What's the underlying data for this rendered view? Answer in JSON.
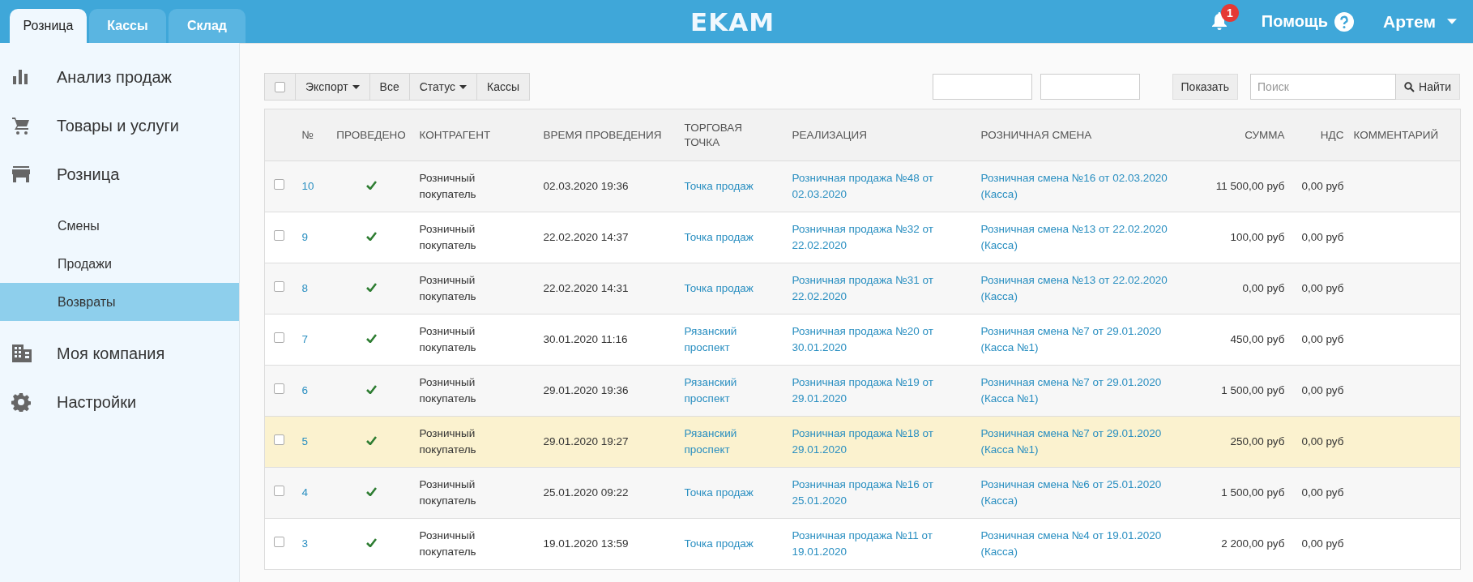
{
  "top_tabs": [
    {
      "label": "Розница",
      "selected": true
    },
    {
      "label": "Кассы",
      "selected": false
    },
    {
      "label": "Склад",
      "selected": false
    }
  ],
  "logo": "EKAM",
  "notifications": {
    "count": "1"
  },
  "help": "Помощь",
  "user": "Артем",
  "sidebar": {
    "items": [
      {
        "label": "Анализ продаж",
        "selected": false
      },
      {
        "label": "Товары и услуги",
        "selected": false
      },
      {
        "label": "Розница",
        "selected": false,
        "children": [
          {
            "label": "Смены",
            "selected": false
          },
          {
            "label": "Продажи",
            "selected": false
          },
          {
            "label": "Возвраты",
            "selected": true
          }
        ]
      },
      {
        "label": "Моя компания",
        "selected": false
      },
      {
        "label": "Настройки",
        "selected": false
      }
    ]
  },
  "toolbar": {
    "select_all": {
      "checked": false
    },
    "buttons": [
      {
        "label": "Экспорт",
        "dropdown": true
      },
      {
        "label": "Все",
        "dropdown": false
      },
      {
        "label": "Статус",
        "dropdown": true
      },
      {
        "label": "Кассы",
        "dropdown": false
      }
    ],
    "show_button": "Показать",
    "search": {
      "placeholder": "Поиск"
    },
    "find_button": "Найти"
  },
  "table": {
    "columns": [
      "№",
      "ПРОВЕДЕНО",
      "КОНТРАГЕНТ",
      "ВРЕМЯ ПРОВЕДЕНИЯ",
      "ТОРГОВАЯ ТОЧКА",
      "РЕАЛИЗАЦИЯ",
      "РОЗНИЧНАЯ СМЕНА",
      "СУММА",
      "НДС",
      "КОММЕНТАРИЙ"
    ],
    "rows": [
      {
        "checked": false,
        "highlighted": false,
        "number": "10",
        "conducted": true,
        "counterparty": "Розничный покупатель",
        "time": "02.03.2020 19:36",
        "point": "Точка продаж",
        "sale": "Розничная продажа №48 от 02.03.2020",
        "shift": "Розничная смена №16 от 02.03.2020 (Касса)",
        "sum": "11 500,00 руб",
        "vat": "0,00 руб"
      },
      {
        "checked": false,
        "highlighted": false,
        "number": "9",
        "conducted": true,
        "counterparty": "Розничный покупатель",
        "time": "22.02.2020 14:37",
        "point": "Точка продаж",
        "sale": "Розничная продажа №32 от 22.02.2020",
        "shift": "Розничная смена №13 от 22.02.2020 (Касса)",
        "sum": "100,00 руб",
        "vat": "0,00 руб"
      },
      {
        "checked": false,
        "highlighted": false,
        "number": "8",
        "conducted": true,
        "counterparty": "Розничный покупатель",
        "time": "22.02.2020 14:31",
        "point": "Точка продаж",
        "sale": "Розничная продажа №31 от 22.02.2020",
        "shift": "Розничная смена №13 от 22.02.2020 (Касса)",
        "sum": "0,00 руб",
        "vat": "0,00 руб"
      },
      {
        "checked": false,
        "highlighted": false,
        "number": "7",
        "conducted": true,
        "counterparty": "Розничный покупатель",
        "time": "30.01.2020 11:16",
        "point": "Рязанский проспект",
        "sale": "Розничная продажа №20 от 30.01.2020",
        "shift": "Розничная смена №7 от 29.01.2020 (Касса №1)",
        "sum": "450,00 руб",
        "vat": "0,00 руб"
      },
      {
        "checked": false,
        "highlighted": false,
        "number": "6",
        "conducted": true,
        "counterparty": "Розничный покупатель",
        "time": "29.01.2020 19:36",
        "point": "Рязанский проспект",
        "sale": "Розничная продажа №19 от 29.01.2020",
        "shift": "Розничная смена №7 от 29.01.2020 (Касса №1)",
        "sum": "1 500,00 руб",
        "vat": "0,00 руб"
      },
      {
        "checked": false,
        "highlighted": true,
        "number": "5",
        "conducted": true,
        "counterparty": "Розничный покупатель",
        "time": "29.01.2020 19:27",
        "point": "Рязанский проспект",
        "sale": "Розничная продажа №18 от 29.01.2020",
        "shift": "Розничная смена №7 от 29.01.2020 (Касса №1)",
        "sum": "250,00 руб",
        "vat": "0,00 руб"
      },
      {
        "checked": false,
        "highlighted": false,
        "number": "4",
        "conducted": true,
        "counterparty": "Розничный покупатель",
        "time": "25.01.2020 09:22",
        "point": "Точка продаж",
        "sale": "Розничная продажа №16 от 25.01.2020",
        "shift": "Розничная смена №6 от 25.01.2020 (Касса)",
        "sum": "1 500,00 руб",
        "vat": "0,00 руб"
      },
      {
        "checked": false,
        "highlighted": false,
        "number": "3",
        "conducted": true,
        "counterparty": "Розничный покупатель",
        "time": "19.01.2020 13:59",
        "point": "Точка продаж",
        "sale": "Розничная продажа №11 от 19.01.2020",
        "shift": "Розничная смена №4 от 19.01.2020 (Касса)",
        "sum": "2 200,00 руб",
        "vat": "0,00 руб"
      }
    ]
  }
}
